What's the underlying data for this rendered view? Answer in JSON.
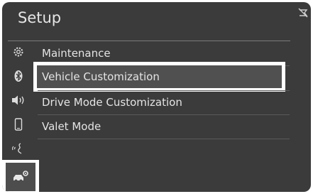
{
  "header": {
    "title": "Setup"
  },
  "sidebar": {
    "items": [
      {
        "icon": "gear-icon"
      },
      {
        "icon": "bluetooth-icon"
      },
      {
        "icon": "speaker-icon"
      },
      {
        "icon": "phone-icon"
      },
      {
        "icon": "voice-icon"
      },
      {
        "icon": "vehicle-settings-icon",
        "selected": true
      }
    ]
  },
  "menu": {
    "items": [
      {
        "label": "Maintenance"
      },
      {
        "label": "Vehicle Customization",
        "selected": true
      },
      {
        "label": "Drive Mode Customization"
      },
      {
        "label": "Valet Mode"
      }
    ]
  },
  "colors": {
    "screen_bg": "#3b3b3b",
    "text": "#e4e4e4",
    "highlight": "#ffffff"
  }
}
